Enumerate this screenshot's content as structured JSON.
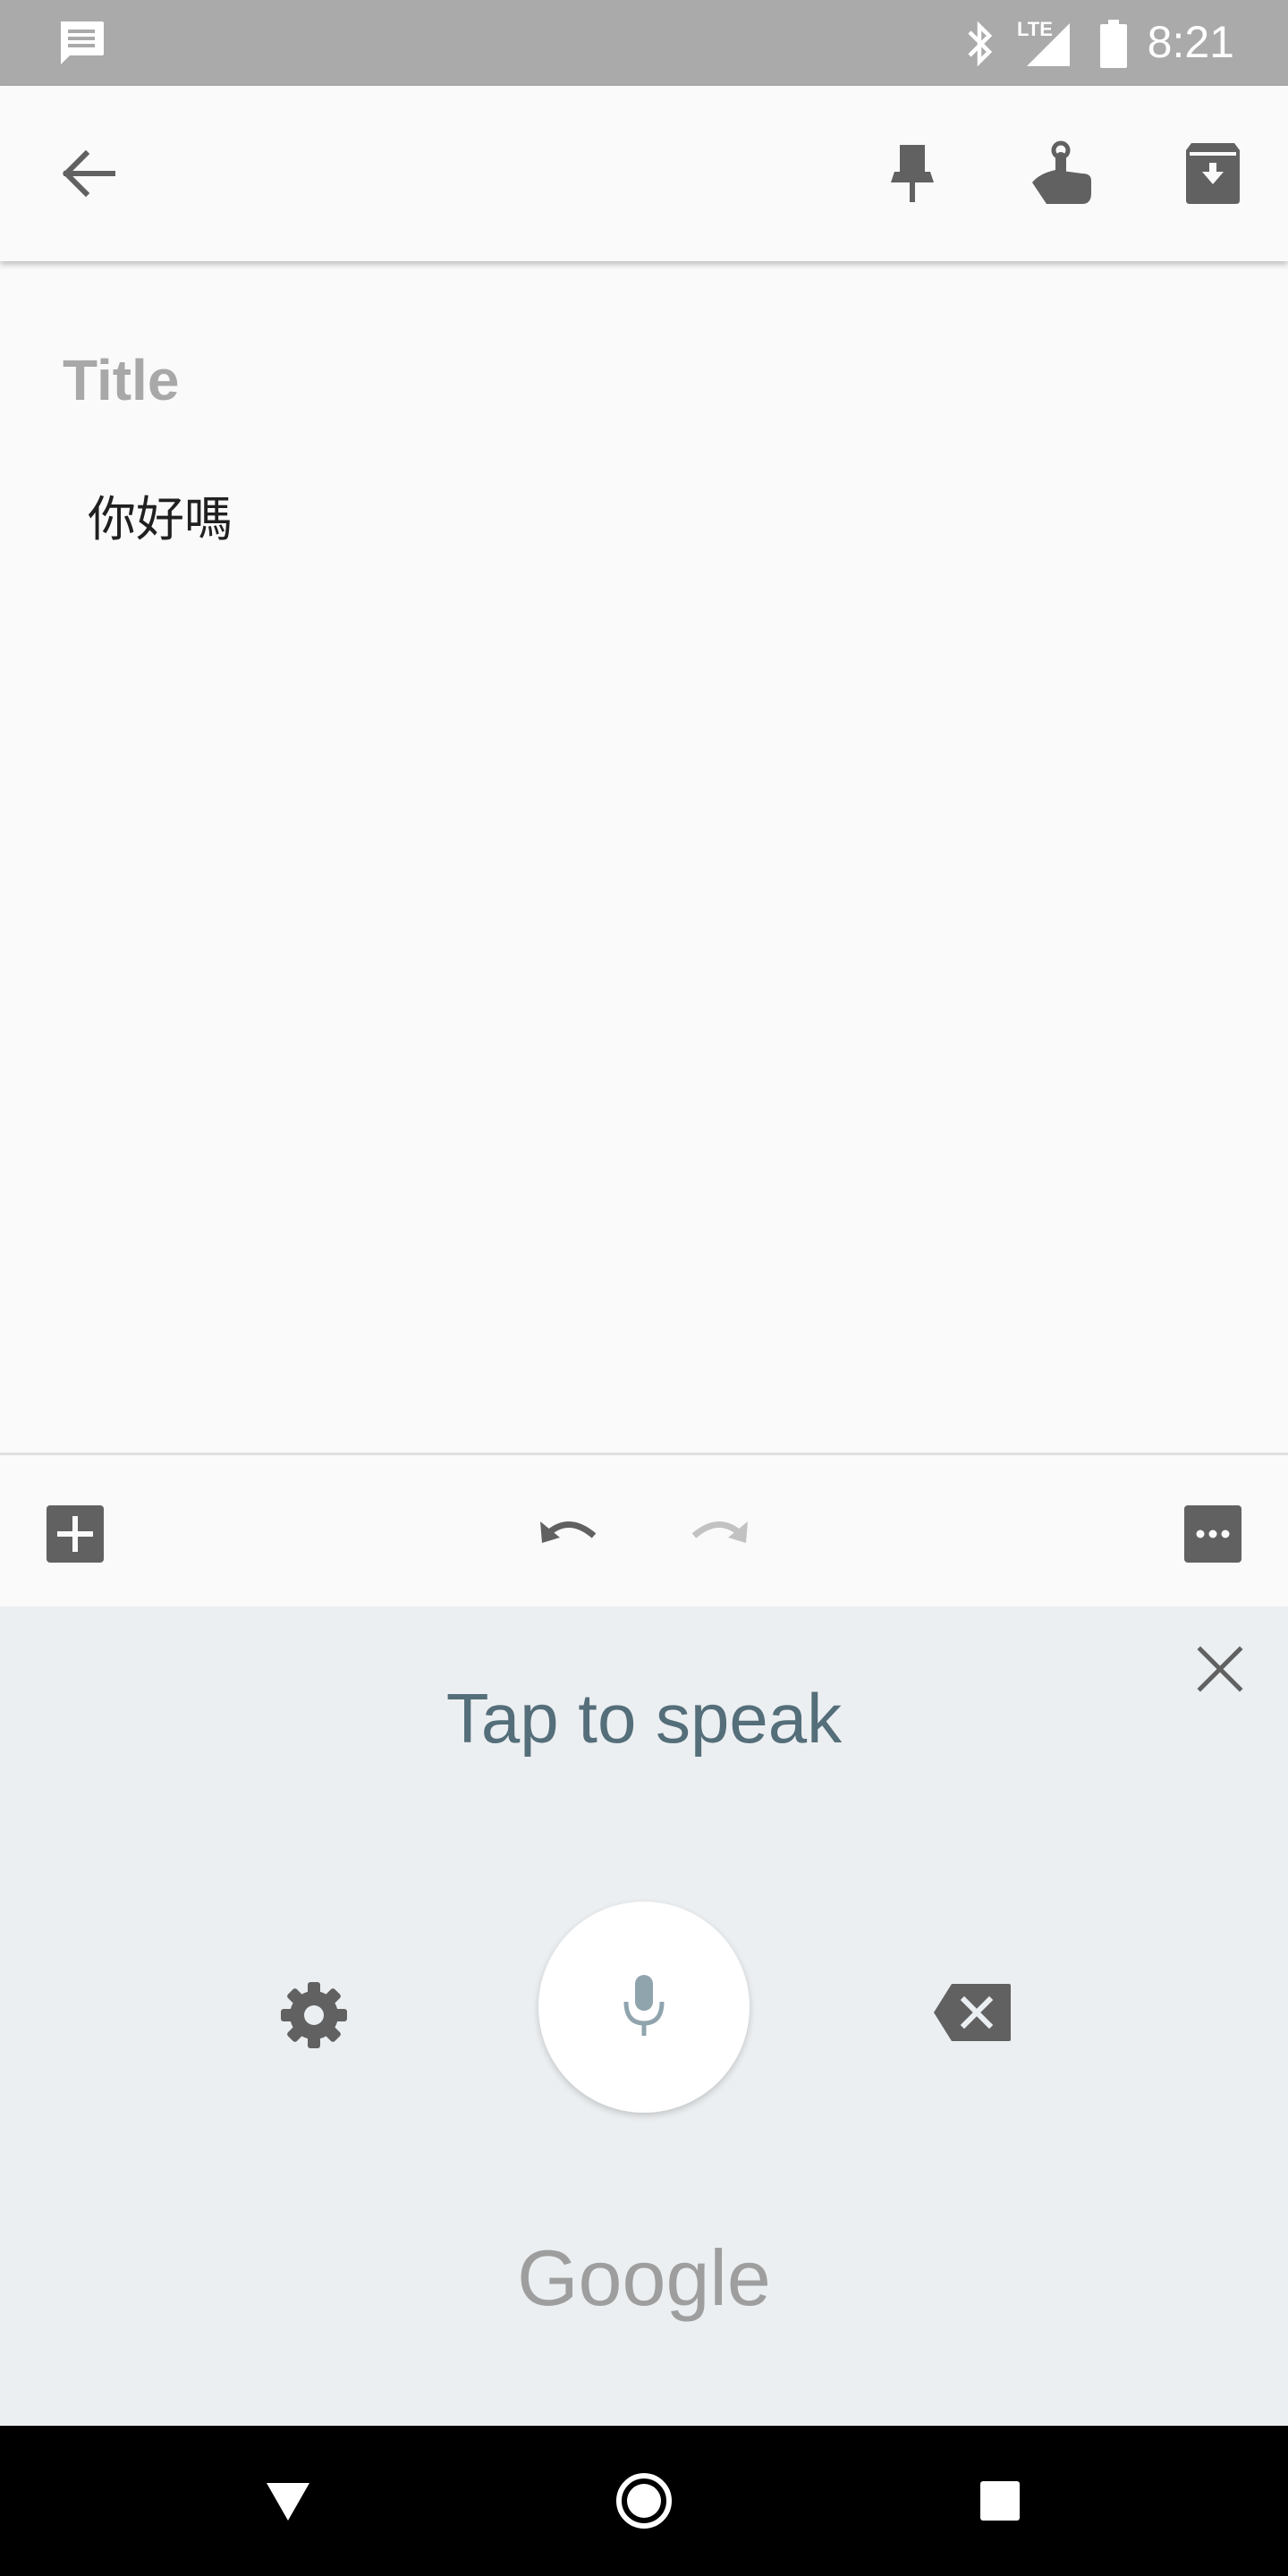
{
  "status_bar": {
    "network_label": "LTE",
    "time": "8:21"
  },
  "toolbar": {
    "icons": [
      "back-arrow-icon",
      "pin-icon",
      "reminder-icon",
      "archive-icon"
    ]
  },
  "note": {
    "title_placeholder": "Title",
    "body_text": "你好嗎"
  },
  "edit_bar": {
    "icons": [
      "add-box-icon",
      "undo-icon",
      "redo-icon",
      "more-icon"
    ]
  },
  "voice_input": {
    "prompt": "Tap to speak",
    "brand": "Google",
    "icons": [
      "close-icon",
      "settings-icon",
      "microphone-icon",
      "backspace-icon"
    ]
  },
  "nav_bar": {
    "icons": [
      "back-triangle-icon",
      "home-circle-icon",
      "recents-square-icon"
    ]
  },
  "colors": {
    "status_bar": "#aaaaaa",
    "background": "#fafafa",
    "voice_panel": "#eceff1",
    "prompt_text": "#546e7a",
    "icon_gray": "#757575"
  }
}
